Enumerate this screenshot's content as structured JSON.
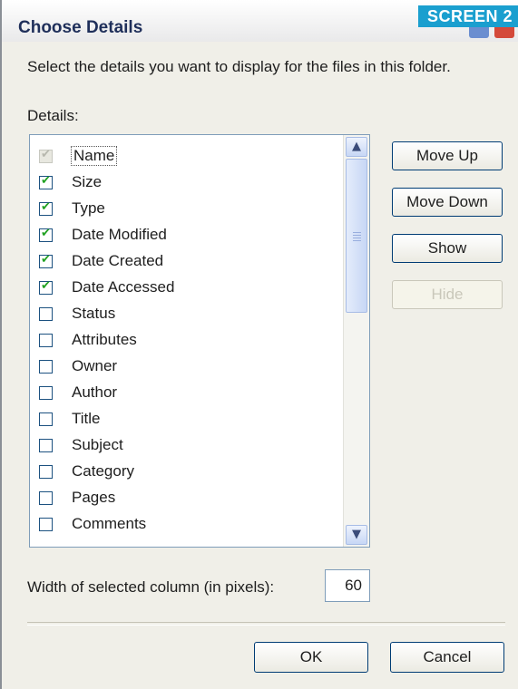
{
  "dialog": {
    "title": "Choose Details",
    "badge": "SCREEN 2",
    "instruction": "Select the details you want to display for the files in this folder.",
    "details_label": "Details:"
  },
  "details": [
    {
      "label": "Name",
      "checked": true,
      "disabled": true,
      "selected": true
    },
    {
      "label": "Size",
      "checked": true
    },
    {
      "label": "Type",
      "checked": true
    },
    {
      "label": "Date Modified",
      "checked": true
    },
    {
      "label": "Date Created",
      "checked": true
    },
    {
      "label": "Date Accessed",
      "checked": true
    },
    {
      "label": "Status",
      "checked": false
    },
    {
      "label": "Attributes",
      "checked": false
    },
    {
      "label": "Owner",
      "checked": false
    },
    {
      "label": "Author",
      "checked": false
    },
    {
      "label": "Title",
      "checked": false
    },
    {
      "label": "Subject",
      "checked": false
    },
    {
      "label": "Category",
      "checked": false
    },
    {
      "label": "Pages",
      "checked": false
    },
    {
      "label": "Comments",
      "checked": false
    }
  ],
  "buttons": {
    "move_up": "Move Up",
    "move_down": "Move Down",
    "show": "Show",
    "hide": "Hide",
    "ok": "OK",
    "cancel": "Cancel"
  },
  "width": {
    "label": "Width of selected column (in pixels):",
    "value": "60"
  },
  "icons": {
    "scroll_up": "chevron-up-icon",
    "scroll_down": "chevron-down-icon"
  }
}
